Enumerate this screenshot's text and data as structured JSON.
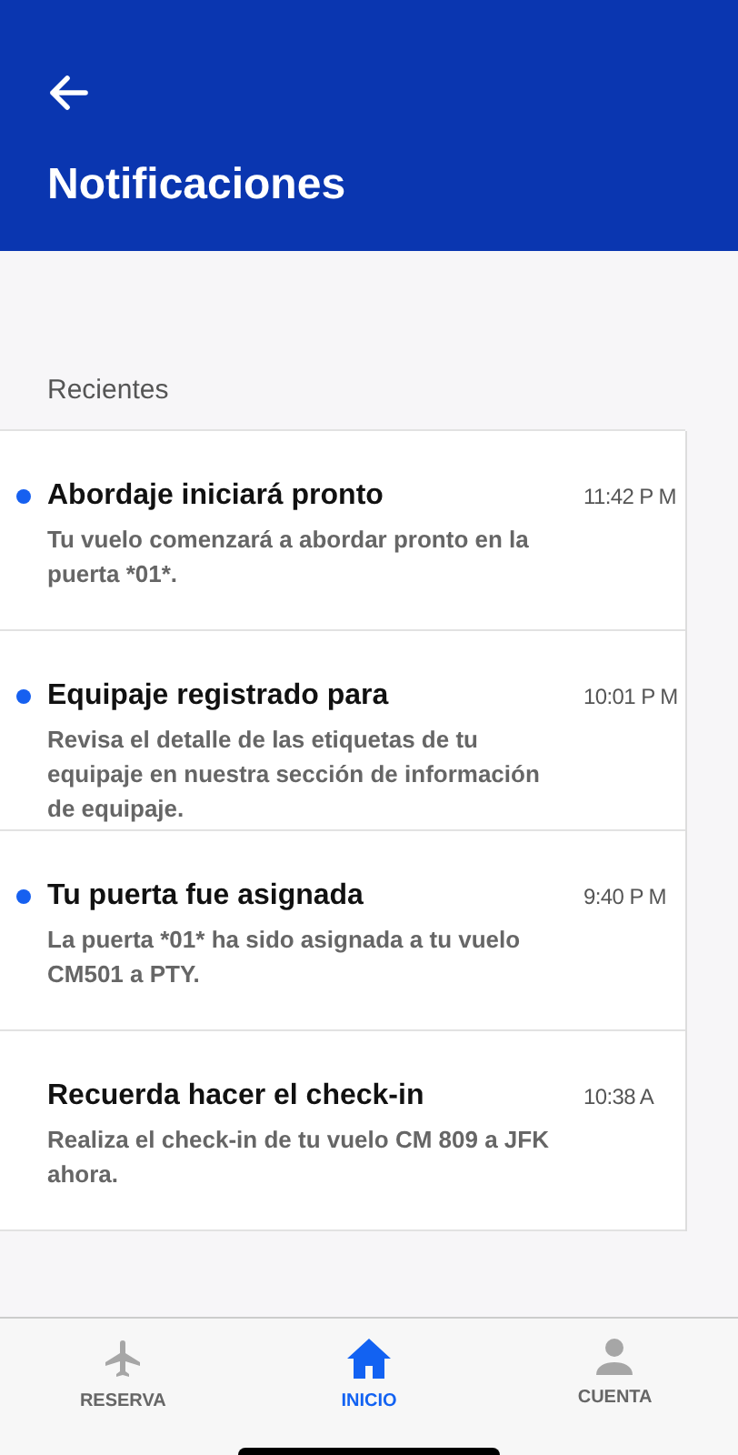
{
  "header": {
    "title": "Notificaciones"
  },
  "section_title": "Recientes",
  "notifications": [
    {
      "title": "Abordaje iniciará pronto",
      "body": "Tu vuelo comenzará a abordar pronto en la puerta *01*.",
      "time": "11:42 P M",
      "unread": true
    },
    {
      "title": "Equipaje registrado para",
      "body": "Revisa el detalle de las etiquetas de tu equipaje en nuestra sección de información de equipaje.",
      "time": "10:01 P M",
      "unread": true
    },
    {
      "title": "Tu puerta fue asignada",
      "body": "La puerta *01* ha sido asignada a tu vuelo CM501 a PTY.",
      "time": "9:40 P M",
      "unread": true
    },
    {
      "title": "Recuerda hacer el check-in",
      "body": "Realiza el check-in de tu vuelo CM 809 a JFK ahora.",
      "time": "10:38 A",
      "unread": false
    }
  ],
  "tab_bar": [
    {
      "kind": "plane",
      "label": "RESERVA",
      "selected": false
    },
    {
      "kind": "home",
      "label": "INICIO",
      "selected": true
    },
    {
      "kind": "person",
      "label": "CUENTA",
      "selected": false
    }
  ]
}
